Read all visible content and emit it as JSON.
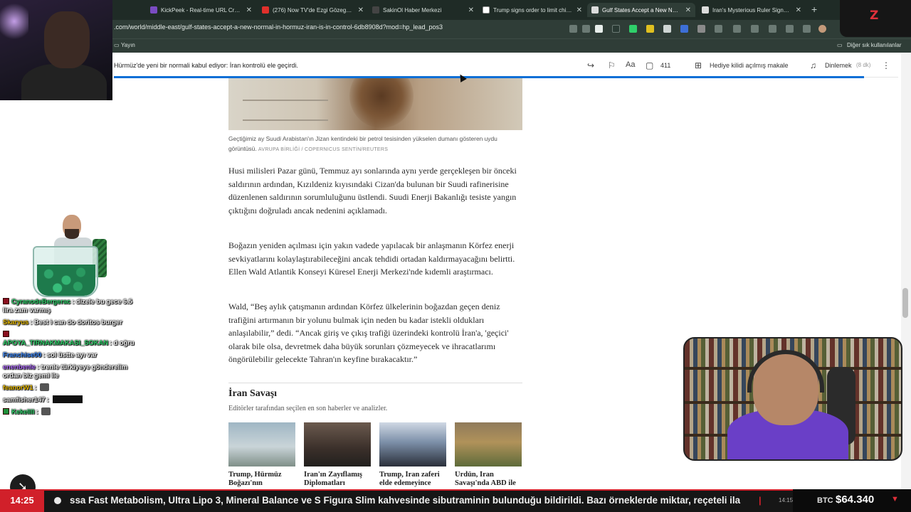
{
  "browser": {
    "tabs": [
      {
        "title": "KickPeek - Real-time URL Crawler",
        "color": "#7a4cc2"
      },
      {
        "title": "(276) Now TV'de Ezgi Gözeger &",
        "color": "#e0302b"
      },
      {
        "title": "SakinOl Haber Merkezi",
        "color": "#222222"
      },
      {
        "title": "Trump signs order to limit childh",
        "color": "#2a5db0"
      },
      {
        "title": "Gulf States Accept a New Norma",
        "color": "#1a1a1a"
      },
      {
        "title": "Iran's Mysterious Ruler Signals a",
        "color": "#1a1a1a"
      }
    ],
    "active_tab": 4,
    "url_main": ".com/world/middle-east/gulf-states-accept-a-new-normal-in-hormuz-iran-is-in-control-6db8908d?mod=hp_lead_pos3",
    "bookmarks_left": "Yayın",
    "bookmarks_right": "Diğer sık kullanılanlar"
  },
  "article_header": {
    "headline": "Hürmüz'de yeni bir normali kabul ediyor: İran kontrolü ele geçirdi.",
    "comments_count": "411",
    "gift_label": "Hediye kilidi açılmış makale",
    "listen_label": "Dinlemek",
    "listen_duration": "(8 dk)"
  },
  "article": {
    "caption": "Geçtiğimiz ay Suudi Arabistan'ın Jizan kentindeki bir petrol tesisinden yükselen dumanı gösteren uydu görüntüsü.",
    "caption_credit": "AVRUPA BİRLİĞİ / COPERNICUS SENTİN/REUTERS",
    "paragraphs": [
      "Husi milisleri Pazar günü, Temmuz ayı sonlarında aynı yerde gerçekleşen bir önceki saldırının ardından, Kızıldeniz kıyısındaki Cizan'da bulunan bir Suudi rafinerisine düzenlenen saldırının sorumluluğunu üstlendi. Suudi Enerji Bakanlığı tesiste yangın çıktığını doğruladı ancak nedenini açıklamadı.",
      "Boğazın yeniden açılması için yakın vadede yapılacak bir anlaşmanın Körfez enerji sevkiyatlarını kolaylaştırabileceğini ancak tehdidi ortadan kaldırmayacağını belirtti. Ellen Wald Atlantik Konseyi Küresel Enerji Merkezi'nde kıdemli araştırmacı.",
      "Wald, “Beş aylık çatışmanın ardından Körfez ülkelerinin boğazdan geçen deniz trafiğini artırmanın bir yolunu bulmak için neden bu kadar istekli oldukları anlaşılabilir,” dedi. “Ancak giriş ve çıkış trafiği üzerindeki kontrolü İran'a, 'geçici' olarak bile olsa, devretmek daha büyük sorunları çözmeyecek ve ihracatlarımı öngörülebilir gelecekte Tahran'ın keyfine bırakacaktır.”"
    ],
    "section_title": "İran Savaşı",
    "section_subtitle": "Editörler tarafından seçilen en son haberler ve analizler.",
    "cards": [
      {
        "title": "Trump, Hürmüz Boğazı'nın"
      },
      {
        "title": "İran'ın Zayıflamış Diplomatları"
      },
      {
        "title": "Trump, İran zaferi elde edemeyince"
      },
      {
        "title": "Ürdün, İran Savaşı'nda ABD ile"
      }
    ]
  },
  "overlay": {
    "logo_letter": "Z",
    "chat": [
      {
        "user": "CyranodeBergerac",
        "user_color": "#2fd06a",
        "text": "dizele bu gece 6.5 lira zam varmış",
        "badge": "red"
      },
      {
        "user": "Skaryus",
        "user_color": "#e6b800",
        "text": "Best i can do doritos burger",
        "badge": "none"
      },
      {
        "user": "APOYA_TIRNAKMAKASI_SOKAN",
        "user_color": "#2fd06a",
        "text": "d oğru",
        "badge": "red"
      },
      {
        "user": "Franchise00",
        "user_color": "#3d8bff",
        "text": "sol üstte ayı var",
        "badge": "none"
      },
      {
        "user": "enenbenle",
        "user_color": "#b06bff",
        "text": "trenle türkiyeye gönderelim ordan biz gemi ile",
        "badge": "none"
      },
      {
        "user": "feanorW1",
        "user_color": "#e6b800",
        "text": "",
        "badge": "none"
      },
      {
        "user": "samfisher147",
        "user_color": "#e0e0e0",
        "text": "",
        "badge": "none"
      },
      {
        "user": "Kekelili",
        "user_color": "#2fd06a",
        "text": "",
        "badge": "green"
      }
    ]
  },
  "ticker": {
    "time": "14:25",
    "text": "ssa Fast Metabolism, Ultra Lipo 3, Mineral Balance ve S Figura Slim kahvesinde sibutraminin bulunduğu bildirildi. Bazı örneklerde miktar, reçeteli ila",
    "time2": "14:15",
    "btc_label": "BTC",
    "btc_value": "$64.340"
  }
}
